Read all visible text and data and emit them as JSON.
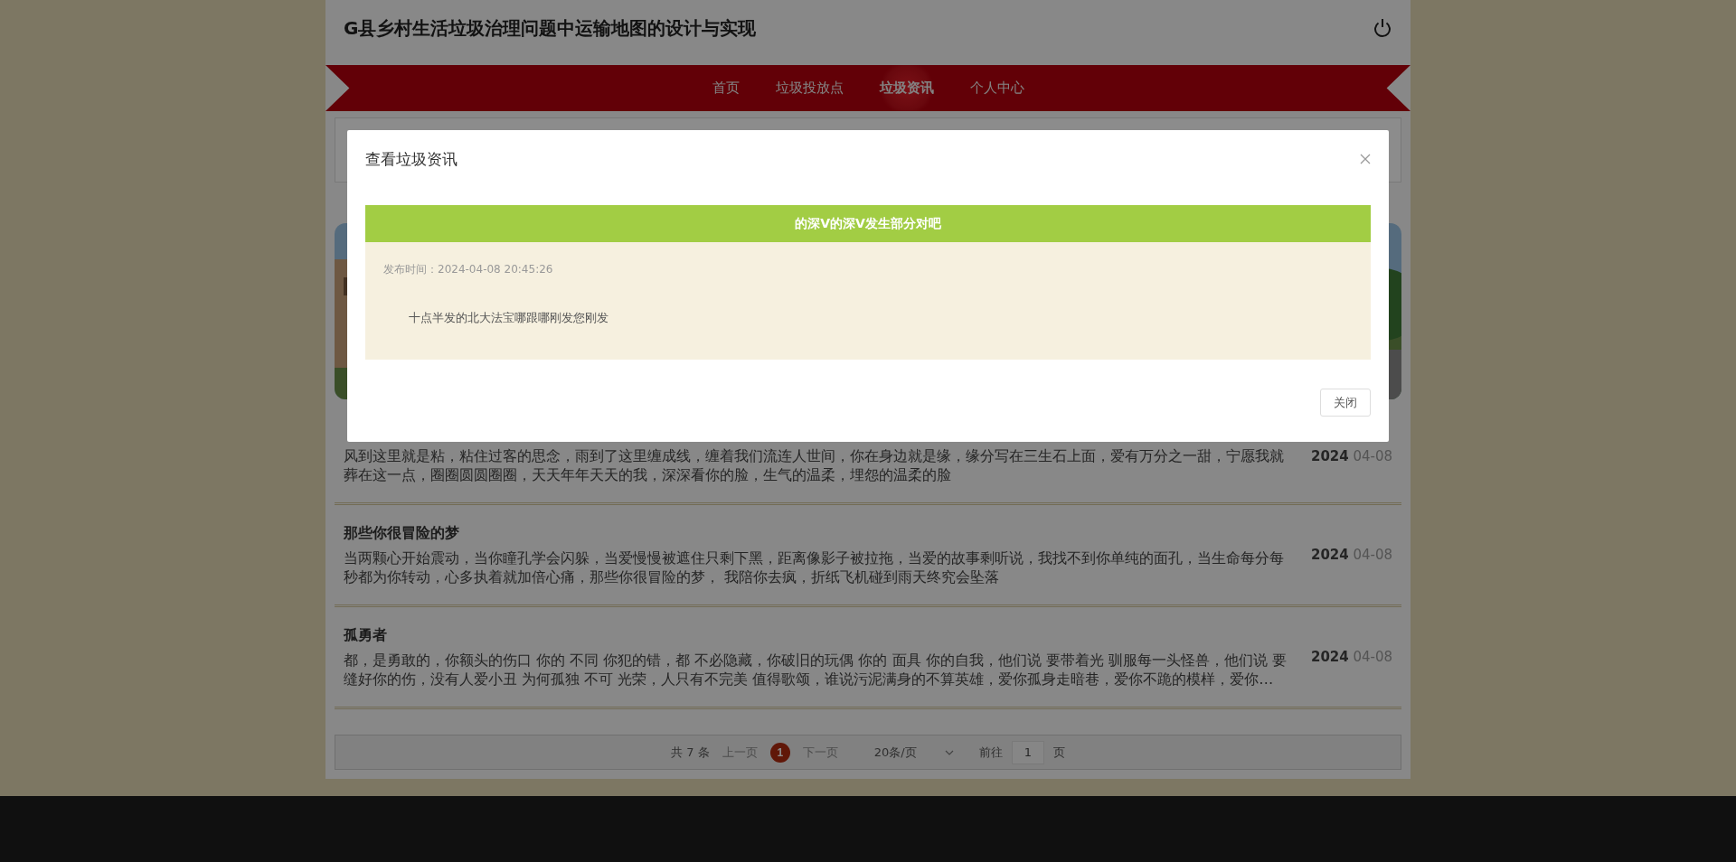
{
  "header": {
    "title": "G县乡村生活垃圾治理问题中运输地图的设计与实现"
  },
  "nav": [
    {
      "label": "首页",
      "selected": false
    },
    {
      "label": "垃圾投放点",
      "selected": false
    },
    {
      "label": "垃圾资讯",
      "selected": true
    },
    {
      "label": "个人中心",
      "selected": false
    }
  ],
  "news": [
    {
      "summary": "风到这里就是粘，粘住过客的思念，雨到了这里缠成线，缠着我们流连人世间，你在身边就是缘，缘分写在三生石上面，爱有万分之一甜，宁愿我就葬在这一点，圈圈圆圆圈圈，天天年年天天的我，深深看你的脸，生气的温柔，埋怨的温柔的脸",
      "year": "2024",
      "date": "04-08"
    },
    {
      "title": "那些你很冒险的梦",
      "summary": "当两颗心开始震动，当你瞳孔学会闪躲，当爱慢慢被遮住只剩下黑，距离像影子被拉拖，当爱的故事剩听说，我找不到你单纯的面孔，当生命每分每秒都为你转动，心多执着就加倍心痛，那些你很冒险的梦， 我陪你去疯，折纸飞机碰到雨天终究会坠落",
      "year": "2024",
      "date": "04-08"
    },
    {
      "title": "孤勇者",
      "summary": "都，是勇敢的，你额头的伤口 你的 不同 你犯的错，都 不必隐藏，你破旧的玩偶 你的 面具 你的自我，他们说 要带着光 驯服每一头怪兽，他们说 要缝好你的伤，没有人爱小丑 为何孤独 不可 光荣，人只有不完美 值得歌颂，谁说污泥满身的不算英雄，爱你孤身走暗巷，爱你不跪的模样，爱你…",
      "year": "2024",
      "date": "04-08"
    }
  ],
  "pagination": {
    "total": "共 7 条",
    "prev": {
      "label": "上一页",
      "disabled": true
    },
    "pages": [
      {
        "label": "1",
        "selected": true
      }
    ],
    "next": {
      "label": "下一页",
      "disabled": true
    },
    "page_size": "20条/页",
    "goto_label": "前往",
    "goto_value": "1",
    "goto_suffix": "页"
  },
  "modal": {
    "title": "查看垃圾资讯",
    "article": {
      "title": "的深V的深V发生部分对吧",
      "time": "发布时间：2024-04-08 20:45:26",
      "body": "十点半发的北大法宝哪跟哪刚发您刚发"
    },
    "buttons": [
      "关闭"
    ]
  }
}
